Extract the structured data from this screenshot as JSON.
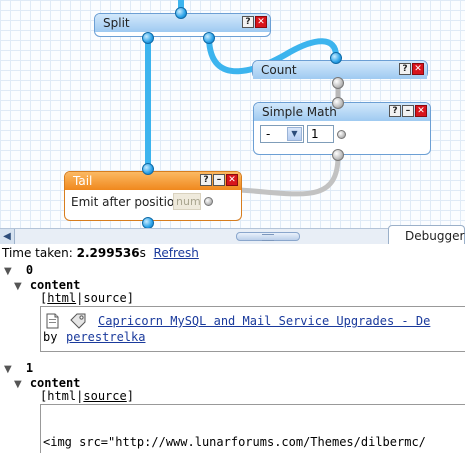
{
  "canvas": {
    "modules": {
      "split": {
        "title": "Split"
      },
      "count": {
        "title": "Count"
      },
      "simple_math": {
        "title": "Simple Math",
        "operator_value": "-",
        "operand_value": "1"
      },
      "tail": {
        "title": "Tail",
        "field_label": "Emit after position",
        "field_placeholder": "num"
      }
    },
    "button_glyphs": {
      "help": "?",
      "minimize": "–",
      "close": "✕"
    }
  },
  "debugger": {
    "tab_label": "Debugger:",
    "time_label": "Time taken:",
    "time_value": "2.299536",
    "time_unit": "s",
    "refresh_label": "Refresh",
    "items": [
      {
        "index": "0",
        "key": "content",
        "tabs": {
          "open": "[",
          "html": "html",
          "sep": "|",
          "source": "source",
          "close": "]"
        },
        "link_text": "Capricorn MySQL and Mail Service Upgrades - De",
        "by_label": "by",
        "author": "perestrelka"
      },
      {
        "index": "1",
        "key": "content",
        "tabs": {
          "open": "[",
          "html": "html",
          "sep": "|",
          "source": "source",
          "close": "]"
        },
        "code_text": "<img src=\"http://www.lunarforums.com/Themes/dilbermc/"
      }
    ]
  },
  "colors": {
    "wire_blue": "#3cb4ee",
    "wire_grey": "#b5b5b5",
    "module_border": "#6c9fd4",
    "tail_header": "#f0881d",
    "link": "#1a3a9c"
  },
  "icons": [
    "page-icon",
    "tag-icon",
    "scroll-left-icon",
    "expand-triangle-icon"
  ]
}
